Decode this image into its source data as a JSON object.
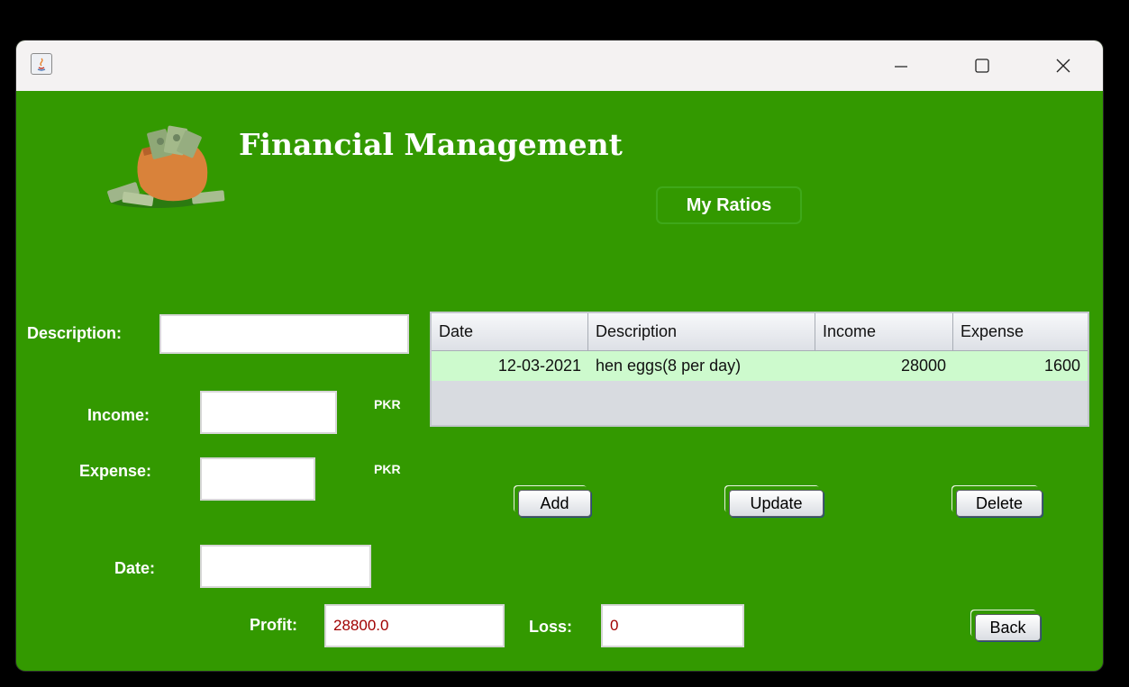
{
  "window": {
    "controls": {
      "minimize": "—",
      "maximize": "☐",
      "close": "✕"
    }
  },
  "header": {
    "title": "Financial Management",
    "ratios_button": "My Ratios",
    "logo_icon": "money-bag-icon"
  },
  "form": {
    "description_label": "Description:",
    "description_value": "",
    "income_label": "Income:",
    "income_value": "",
    "income_unit": "PKR",
    "expense_label": "Expense:",
    "expense_value": "",
    "expense_unit": "PKR",
    "date_label": "Date:",
    "date_value": ""
  },
  "table": {
    "columns": [
      "Date",
      "Description",
      "Income",
      "Expense"
    ],
    "rows": [
      {
        "date": "12-03-2021",
        "description": "hen eggs(8 per day)",
        "income": "28000",
        "expense": "1600"
      }
    ]
  },
  "actions": {
    "add": "Add",
    "update": "Update",
    "delete": "Delete",
    "back": "Back"
  },
  "summary": {
    "profit_label": "Profit:",
    "profit_value": "28800.0",
    "loss_label": "Loss:",
    "loss_value": "0"
  },
  "colors": {
    "background": "#339900",
    "selected_row": "#cdfacd",
    "value_text": "#a00000"
  }
}
